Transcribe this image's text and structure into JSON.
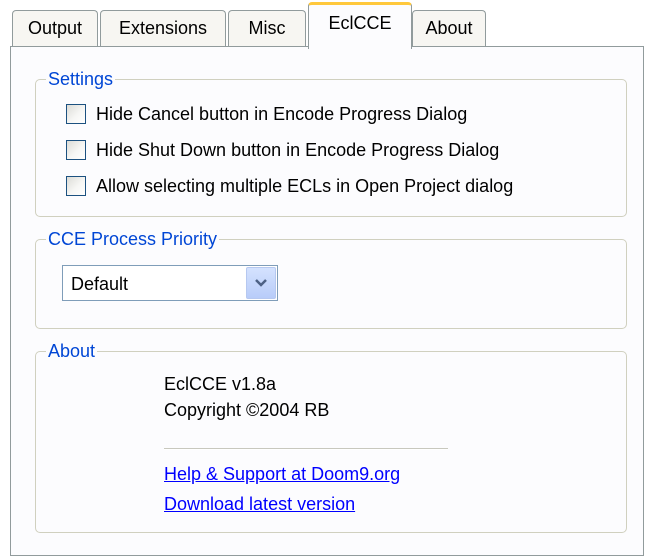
{
  "tabs": [
    {
      "label": "Output"
    },
    {
      "label": "Extensions"
    },
    {
      "label": "Misc"
    },
    {
      "label": "EclCCE"
    },
    {
      "label": "About"
    }
  ],
  "settings": {
    "legend": "Settings",
    "options": [
      {
        "label": "Hide Cancel button in Encode Progress Dialog",
        "checked": false
      },
      {
        "label": "Hide Shut Down button in Encode Progress Dialog",
        "checked": false
      },
      {
        "label": "Allow selecting multiple ECLs in Open Project dialog",
        "checked": false
      }
    ]
  },
  "priority": {
    "legend": "CCE Process Priority",
    "selected": "Default"
  },
  "about": {
    "legend": "About",
    "version": "EclCCE v1.8a",
    "copyright": "Copyright ©2004 RB",
    "help_link": "Help & Support at Doom9.org",
    "download_link": "Download latest version"
  },
  "colors": {
    "legend_text": "#0046d5",
    "link_text": "#0000ff",
    "active_tab_accent": "#ffc83c"
  }
}
